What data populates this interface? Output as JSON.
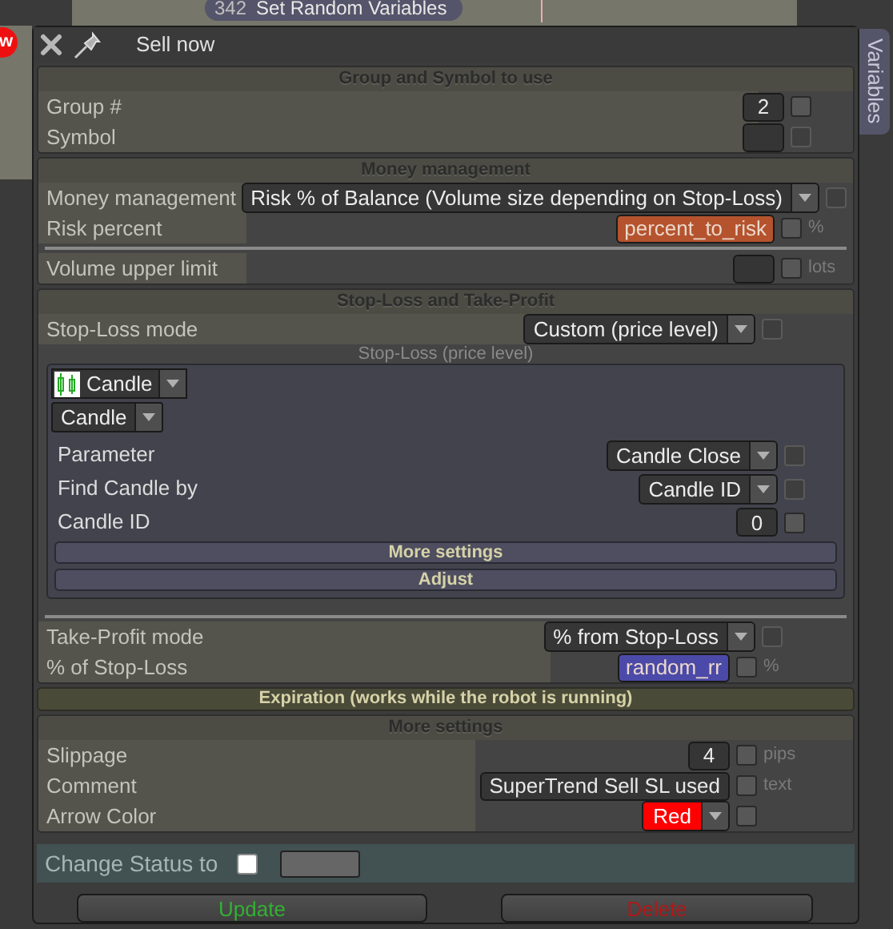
{
  "background": {
    "node": {
      "number": "342",
      "label": "Set Random Variables"
    },
    "badge": "w"
  },
  "side_tab": "Variables",
  "dialog": {
    "title": "Sell now"
  },
  "sections": [
    {
      "kind": "panel",
      "title": "Group and Symbol to use",
      "groups": [
        [
          {
            "kind": "input",
            "label": "Group #",
            "value": "2",
            "checkbox_disabled": false
          },
          {
            "kind": "input",
            "label": "Symbol",
            "checkbox_disabled": true
          }
        ]
      ]
    },
    {
      "kind": "panel",
      "title": "Money management",
      "groups": [
        [
          {
            "kind": "dropdown",
            "label": "Money management",
            "value": "Risk % of Balance (Volume size depending on Stop-Loss)",
            "checkbox_disabled": true
          },
          {
            "kind": "variable",
            "label": "Risk percent",
            "value": "percent_to_risk",
            "color": "#b4532e",
            "unit": "%",
            "checkbox_disabled": false
          }
        ],
        [
          {
            "kind": "input",
            "label": "Volume upper limit",
            "unit": "lots",
            "checkbox_disabled": false
          }
        ]
      ]
    },
    {
      "kind": "panel",
      "title": "Stop-Loss and Take-Profit",
      "groups": [
        [
          {
            "kind": "dropdown",
            "label": "Stop-Loss mode",
            "value": "Custom (price level)",
            "checkbox_disabled": true
          },
          {
            "kind": "subpanel",
            "title": "Stop-Loss (price level)",
            "source": "Candle",
            "type": "Candle",
            "rows": [
              {
                "kind": "dropdown",
                "label": "Parameter",
                "value": "Candle Close",
                "checkbox_disabled": true
              },
              {
                "kind": "dropdown",
                "label": "Find Candle by",
                "value": "Candle ID",
                "checkbox_disabled": true
              },
              {
                "kind": "input",
                "label": "Candle ID",
                "value": "0",
                "checkbox_disabled": false
              }
            ],
            "bars": [
              "More settings",
              "Adjust"
            ]
          }
        ],
        [
          {
            "kind": "dropdown",
            "label": "Take-Profit mode",
            "value": "% from Stop-Loss",
            "checkbox_disabled": true
          },
          {
            "kind": "variable",
            "label": "% of Stop-Loss",
            "value": "random_rr",
            "color": "#4b4aa8",
            "unit": "%",
            "checkbox_disabled": false
          }
        ]
      ]
    },
    {
      "kind": "collapsed",
      "title": "Expiration (works while the robot is running)"
    },
    {
      "kind": "panel",
      "title": "More settings",
      "groups": [
        [
          {
            "kind": "input",
            "label": "Slippage",
            "value": "4",
            "unit": "pips",
            "checkbox_disabled": false
          },
          {
            "kind": "input",
            "label": "Comment",
            "value": "SuperTrend Sell SL used",
            "unit": "text",
            "checkbox_disabled": false
          },
          {
            "kind": "color_dropdown",
            "label": "Arrow Color",
            "value": "Red",
            "color": "#ff0000",
            "checkbox_disabled": false
          }
        ]
      ]
    },
    {
      "kind": "status",
      "label": "Change Status to",
      "checked": false
    }
  ],
  "buttons": [
    {
      "kind": "confirm",
      "label": "Update"
    },
    {
      "kind": "danger",
      "label": "Delete"
    }
  ]
}
